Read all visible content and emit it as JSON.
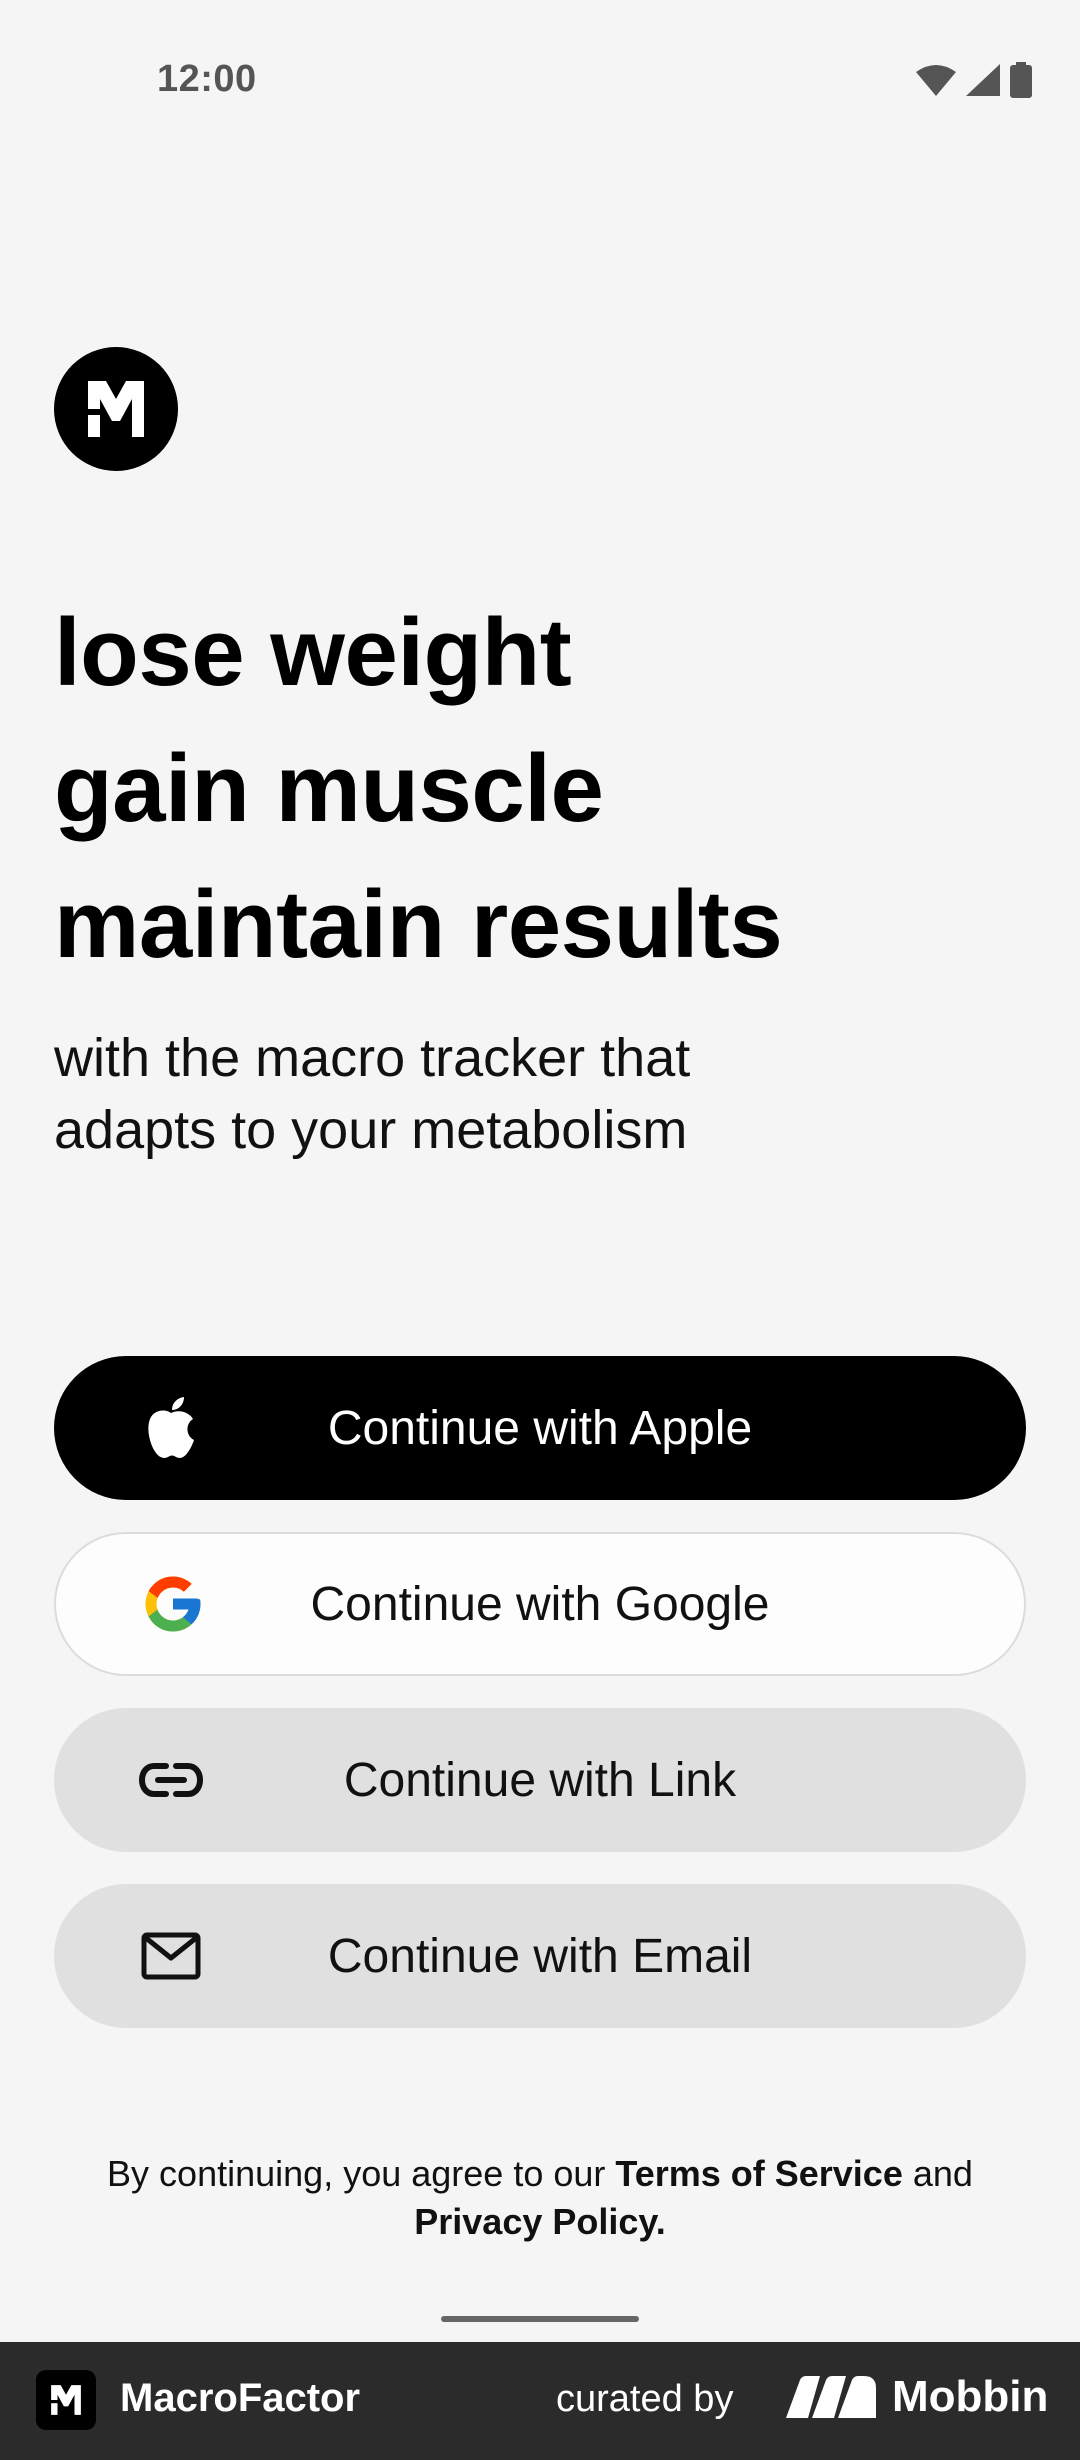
{
  "status_bar": {
    "time": "12:00"
  },
  "brand": {
    "logo_icon": "macrofactor-logo-icon"
  },
  "headline": {
    "line1": "lose weight",
    "line2": "gain muscle",
    "line3": "maintain results"
  },
  "subtext": {
    "line1": "with the macro tracker that",
    "line2": "adapts to your metabolism"
  },
  "buttons": {
    "apple": "Continue with Apple",
    "google": "Continue with Google",
    "link": "Continue with Link",
    "email": "Continue with Email"
  },
  "legal": {
    "prefix": "By continuing, you agree to our ",
    "terms": "Terms of Service",
    "and": " and",
    "privacy": "Privacy Policy."
  },
  "footer": {
    "app_name": "MacroFactor",
    "curated_by": "curated by",
    "mobbin": "Mobbin"
  },
  "colors": {
    "background": "#f5f5f5",
    "primary_button": "#000000",
    "secondary_button": "#e0e0e0",
    "footer": "#2b2b2b"
  }
}
